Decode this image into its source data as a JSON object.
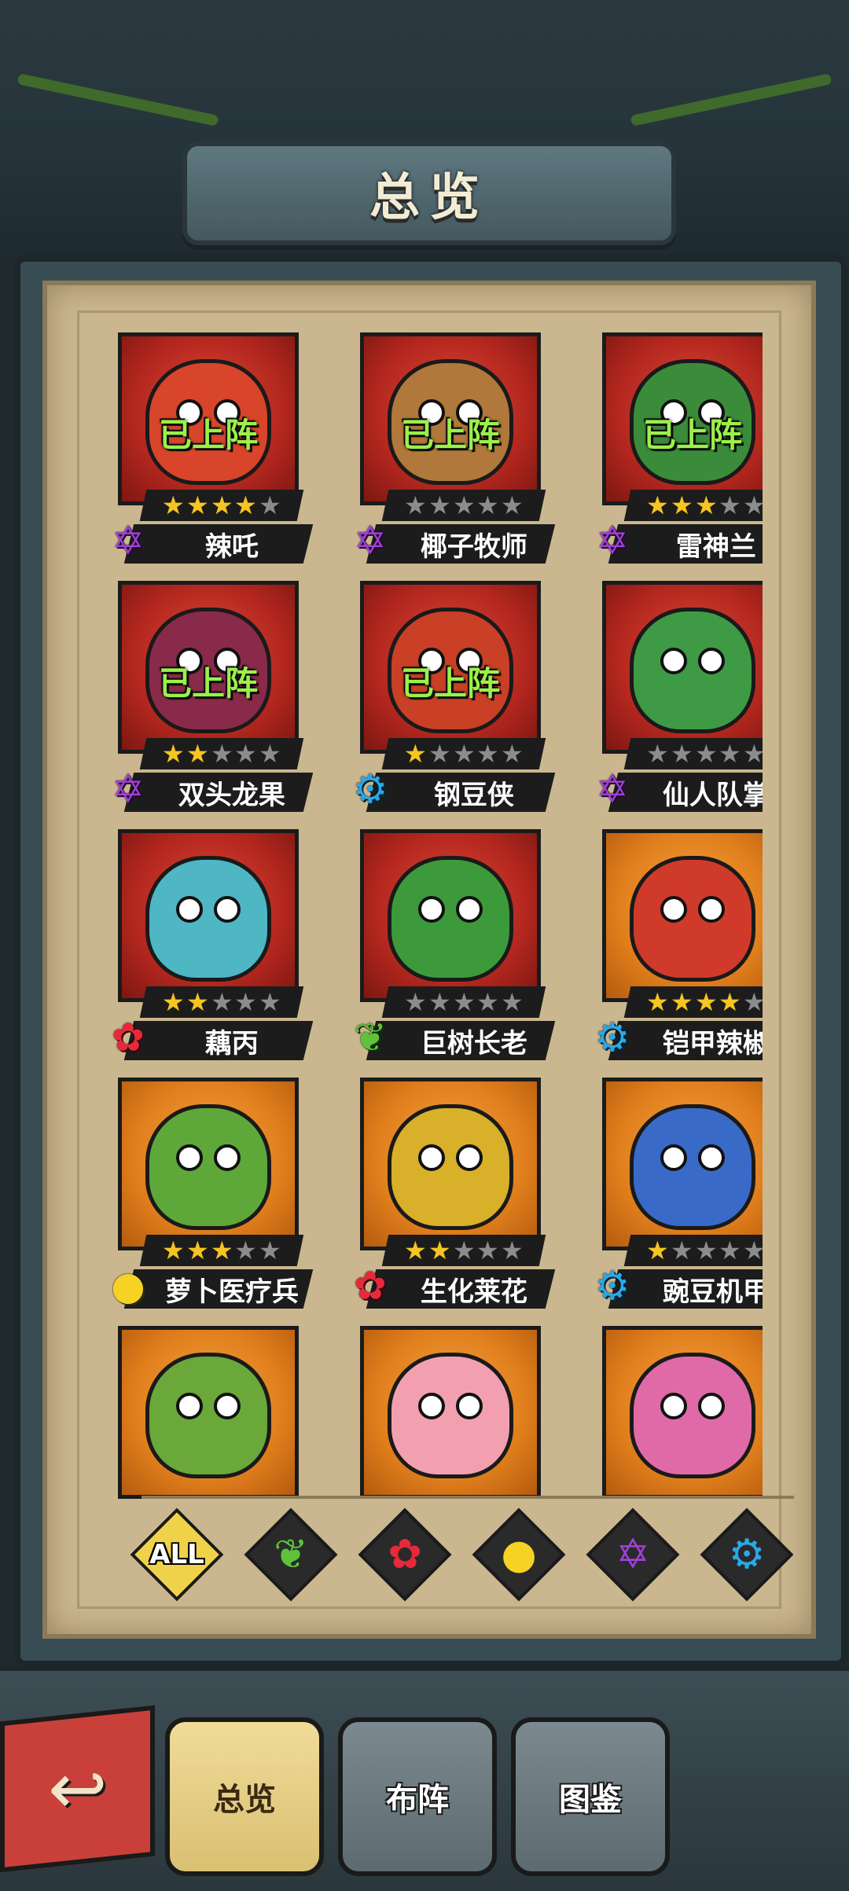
{
  "title": "总览",
  "on_team_label": "已上阵",
  "heroes": [
    {
      "name": "辣吒",
      "stars": 4,
      "on_team": true,
      "faction": "violet",
      "faction_icon": "✡",
      "bg": "red",
      "body": "#d8452a"
    },
    {
      "name": "椰子牧师",
      "stars": 0,
      "on_team": true,
      "faction": "violet",
      "faction_icon": "✡",
      "bg": "red",
      "body": "#b0783a"
    },
    {
      "name": "雷神兰",
      "stars": 3,
      "on_team": true,
      "faction": "violet",
      "faction_icon": "✡",
      "bg": "red",
      "body": "#3b8c3a"
    },
    {
      "name": "双头龙果",
      "stars": 2,
      "on_team": true,
      "faction": "violet",
      "faction_icon": "✡",
      "bg": "red",
      "body": "#8a2a4a"
    },
    {
      "name": "钢豆侠",
      "stars": 1,
      "on_team": true,
      "faction": "blue",
      "faction_icon": "⚙",
      "bg": "red",
      "body": "#c94026"
    },
    {
      "name": "仙人队掌",
      "stars": 0,
      "on_team": false,
      "faction": "violet",
      "faction_icon": "✡",
      "bg": "red",
      "body": "#3f9a46"
    },
    {
      "name": "藕丙",
      "stars": 2,
      "on_team": false,
      "faction": "red",
      "faction_icon": "✿",
      "bg": "red",
      "body": "#4fb6c4"
    },
    {
      "name": "巨树长老",
      "stars": 0,
      "on_team": false,
      "faction": "green",
      "faction_icon": "❦",
      "bg": "red",
      "body": "#3c9a3a"
    },
    {
      "name": "铠甲辣椒",
      "stars": 4,
      "on_team": false,
      "faction": "blue",
      "faction_icon": "⚙",
      "bg": "orange",
      "body": "#d03a2a"
    },
    {
      "name": "萝卜医疗兵",
      "stars": 3,
      "on_team": false,
      "faction": "yellow",
      "faction_icon": "●",
      "bg": "orange",
      "body": "#5ea83a"
    },
    {
      "name": "生化莱花",
      "stars": 2,
      "on_team": false,
      "faction": "red",
      "faction_icon": "✿",
      "bg": "orange",
      "body": "#d8b02a"
    },
    {
      "name": "豌豆机甲",
      "stars": 1,
      "on_team": false,
      "faction": "blue",
      "faction_icon": "⚙",
      "bg": "orange",
      "body": "#3a6ac8"
    },
    {
      "name": "",
      "stars": 0,
      "on_team": false,
      "faction": "",
      "faction_icon": "",
      "bg": "orange",
      "body": "#6aa83a"
    },
    {
      "name": "",
      "stars": 0,
      "on_team": false,
      "faction": "",
      "faction_icon": "",
      "bg": "orange",
      "body": "#f2a0b0"
    },
    {
      "name": "",
      "stars": 0,
      "on_team": false,
      "faction": "",
      "faction_icon": "",
      "bg": "orange",
      "body": "#e06aa8"
    }
  ],
  "filters": [
    {
      "id": "all",
      "label": "ALL",
      "icon": "",
      "active": true
    },
    {
      "id": "green",
      "label": "",
      "icon": "❦",
      "color": "#5fc23a"
    },
    {
      "id": "red",
      "label": "",
      "icon": "✿",
      "color": "#e8293a"
    },
    {
      "id": "yellow",
      "label": "",
      "icon": "●",
      "color": "#f6d224"
    },
    {
      "id": "violet",
      "label": "",
      "icon": "✡",
      "color": "#a040d8"
    },
    {
      "id": "blue",
      "label": "",
      "icon": "⚙",
      "color": "#2aa8e8"
    }
  ],
  "back_icon": "↩",
  "tabs": [
    {
      "id": "overview",
      "label": "总览",
      "active": true
    },
    {
      "id": "formation",
      "label": "布阵",
      "active": false
    },
    {
      "id": "codex",
      "label": "图鉴",
      "active": false
    }
  ]
}
